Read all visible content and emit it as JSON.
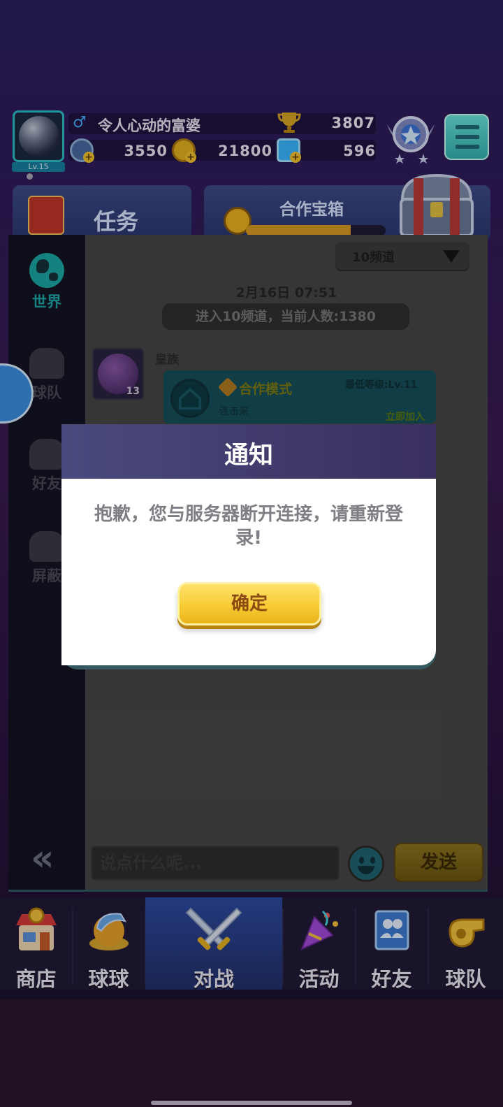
{
  "player": {
    "level": "Lv.15",
    "name": "令人心动的富婆",
    "trophies": "3807"
  },
  "resources": [
    {
      "icon": "energy-icon",
      "value": "3550"
    },
    {
      "icon": "gold-coin-icon",
      "value": "21800"
    },
    {
      "icon": "diamond-icon",
      "value": "596"
    }
  ],
  "panels": {
    "task_label": "任务",
    "coop_label": "合作宝箱",
    "coop_progress": 0.75
  },
  "chat": {
    "sidebar": [
      {
        "label": "世界",
        "icon": "globe-icon",
        "active": true
      },
      {
        "label": "球队",
        "icon": "whistle-icon",
        "active": false
      },
      {
        "label": "好友",
        "icon": "friends-icon",
        "active": false
      },
      {
        "label": "屏蔽",
        "icon": "block-user-icon",
        "active": false
      }
    ],
    "channel": "10频道",
    "time": "2月16日 07:51",
    "system_message": "进入10频道，当前人数:1380",
    "message": {
      "sender": "皇族",
      "avatar_level": "13",
      "card_title": "合作模式",
      "card_min_level": "最低等级:Lv.11",
      "card_sub": "连击来",
      "card_join": "立即加入"
    },
    "input_placeholder": "说点什么呢...",
    "send_label": "发送"
  },
  "dialog": {
    "title": "通知",
    "message": "抱歉，您与服务器断开连接，请重新登录!",
    "confirm_label": "确定"
  },
  "nav": [
    {
      "label": "商店",
      "icon": "shop-icon",
      "active": false
    },
    {
      "label": "球球",
      "icon": "ball-icon",
      "active": false
    },
    {
      "label": "对战",
      "icon": "crossed-swords-icon",
      "active": true
    },
    {
      "label": "活动",
      "icon": "party-popper-icon",
      "active": false
    },
    {
      "label": "好友",
      "icon": "friends-book-icon",
      "active": false
    },
    {
      "label": "球队",
      "icon": "whistle-icon",
      "active": false
    }
  ],
  "colors": {
    "accent_teal": "#1ea7a8",
    "confirm_yellow": "#f7c930",
    "dialog_header": "#4a4a7e"
  }
}
